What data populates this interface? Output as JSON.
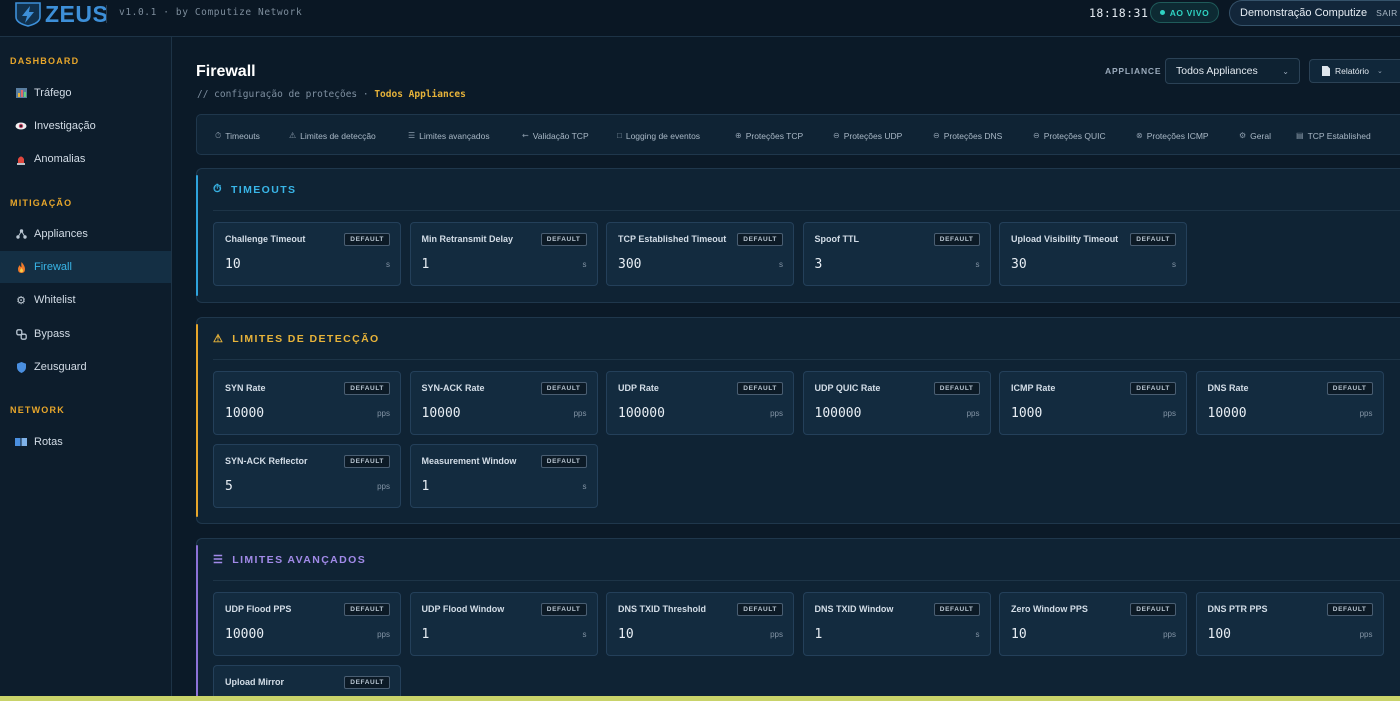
{
  "header": {
    "logo_text": "ZEUS",
    "version": "v1.0.1 · by Computize Network",
    "clock": "18:18:31",
    "live_label": "AO VIVO",
    "user_name": "Demonstração Computize",
    "logout_label": "SAIR"
  },
  "sidebar": {
    "sections": [
      {
        "title": "DASHBOARD",
        "items": [
          {
            "label": "Tráfego",
            "icon": "chart-icon"
          },
          {
            "label": "Investigação",
            "icon": "eye-icon"
          },
          {
            "label": "Anomalias",
            "icon": "alert-icon"
          }
        ]
      },
      {
        "title": "MITIGAÇÃO",
        "items": [
          {
            "label": "Appliances",
            "icon": "network-icon"
          },
          {
            "label": "Firewall",
            "icon": "fire-icon",
            "active": true
          },
          {
            "label": "Whitelist",
            "icon": "gear-icon"
          },
          {
            "label": "Bypass",
            "icon": "chain-icon"
          },
          {
            "label": "Zeusguard",
            "icon": "shield-icon"
          }
        ]
      },
      {
        "title": "NETWORK",
        "items": [
          {
            "label": "Rotas",
            "icon": "book-icon"
          }
        ]
      }
    ]
  },
  "page": {
    "title": "Firewall",
    "subtitle_prefix": "// configuração de proteções ·",
    "subtitle_highlight": "Todos Appliances",
    "appliance_label": "APPLIANCE",
    "appliance_selected": "Todos Appliances",
    "report_label": "Relatório"
  },
  "tabs": [
    {
      "label": "Timeouts",
      "icon": "timer-icon"
    },
    {
      "label": "Limites de detecção",
      "icon": "warning-icon"
    },
    {
      "label": "Limites avançados",
      "icon": "list-icon"
    },
    {
      "label": "Validação TCP",
      "icon": "handshake-icon"
    },
    {
      "label": "Logging de eventos",
      "icon": "square-icon"
    },
    {
      "label": "Proteções TCP",
      "icon": "globe-icon"
    },
    {
      "label": "Proteções UDP",
      "icon": "globe-icon"
    },
    {
      "label": "Proteções DNS",
      "icon": "globe-icon"
    },
    {
      "label": "Proteções QUIC",
      "icon": "globe-icon"
    },
    {
      "label": "Proteções ICMP",
      "icon": "globe-icon"
    },
    {
      "label": "Geral",
      "icon": "gear-icon"
    },
    {
      "label": "TCP Established",
      "icon": "table-icon"
    }
  ],
  "default_badge": "DEFAULT",
  "sections": {
    "timeouts": {
      "title": "TIMEOUTS",
      "fields": [
        {
          "label": "Challenge Timeout",
          "value": "10",
          "unit": "s"
        },
        {
          "label": "Min Retransmit Delay",
          "value": "1",
          "unit": "s"
        },
        {
          "label": "TCP Established Timeout",
          "value": "300",
          "unit": "s"
        },
        {
          "label": "Spoof TTL",
          "value": "3",
          "unit": "s"
        },
        {
          "label": "Upload Visibility Timeout",
          "value": "30",
          "unit": "s"
        }
      ]
    },
    "detection": {
      "title": "LIMITES DE DETECÇÃO",
      "fields": [
        {
          "label": "SYN Rate",
          "value": "10000",
          "unit": "pps"
        },
        {
          "label": "SYN-ACK Rate",
          "value": "10000",
          "unit": "pps"
        },
        {
          "label": "UDP Rate",
          "value": "100000",
          "unit": "pps"
        },
        {
          "label": "UDP QUIC Rate",
          "value": "100000",
          "unit": "pps"
        },
        {
          "label": "ICMP Rate",
          "value": "1000",
          "unit": "pps"
        },
        {
          "label": "DNS Rate",
          "value": "10000",
          "unit": "pps"
        },
        {
          "label": "SYN-ACK Reflector",
          "value": "5",
          "unit": "pps"
        },
        {
          "label": "Measurement Window",
          "value": "1",
          "unit": "s"
        }
      ]
    },
    "advanced": {
      "title": "LIMITES AVANÇADOS",
      "fields": [
        {
          "label": "UDP Flood PPS",
          "value": "10000",
          "unit": "pps"
        },
        {
          "label": "UDP Flood Window",
          "value": "1",
          "unit": "s"
        },
        {
          "label": "DNS TXID Threshold",
          "value": "10",
          "unit": "pps"
        },
        {
          "label": "DNS TXID Window",
          "value": "1",
          "unit": "s"
        },
        {
          "label": "Zero Window PPS",
          "value": "10",
          "unit": "pps"
        },
        {
          "label": "DNS PTR PPS",
          "value": "100",
          "unit": "pps"
        },
        {
          "label": "Upload Mirror",
          "value": "",
          "unit": ""
        }
      ]
    }
  },
  "colors": {
    "accent_blue": "#39b6e8",
    "accent_amber": "#e7a62b",
    "accent_purple": "#a18ae8",
    "live_green": "#2fd3c2"
  }
}
